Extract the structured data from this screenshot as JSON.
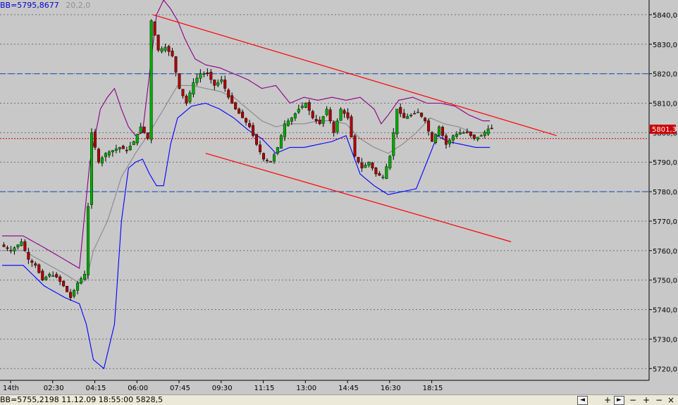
{
  "indicator_label": {
    "value_text": "BB=5795,8677",
    "params_text": "20,2,0",
    "value_color": "#0000cc",
    "params_color": "#909090"
  },
  "status": {
    "text": "BB=5755,2198  11.12.09 18:55:00 5828,5"
  },
  "nav": {
    "icons": [
      "left-arrow-icon",
      "right-arrow-icon",
      "plus-icon",
      "minus-icon",
      "zoom-in-icon",
      "zoom-out-icon",
      "zoom-reset-icon"
    ],
    "glyphs": [
      "◄",
      "►",
      "+",
      "−",
      "+",
      "−",
      "×"
    ]
  },
  "colors": {
    "background": "#c8c8c8",
    "grid": "#707070",
    "candle_up": "#00aa00",
    "candle_down": "#aa0000",
    "wick": "#000000",
    "bb_upper": "#880088",
    "bb_lower": "#0000ff",
    "bb_middle": "#888888",
    "trendline": "#ff0000",
    "level_line": "#3060c0",
    "current_price_line": "#cc0000",
    "price_tag_bg": "#cc0000",
    "price_tag_text": "#ffffff"
  },
  "chart_data": {
    "type": "candlestick",
    "y_axis": {
      "min": 5716,
      "max": 5845,
      "ticks": [
        5720,
        5730,
        5740,
        5750,
        5760,
        5770,
        5780,
        5790,
        5800,
        5810,
        5820,
        5830,
        5840
      ],
      "tick_labels": [
        "5720,0",
        "5730,0",
        "5740,0",
        "5750,0",
        "5760,0",
        "5770,0",
        "5780,0",
        "5790,0",
        "5800,0",
        "5810,0",
        "5820,0",
        "5830,0",
        "5840,0"
      ]
    },
    "x_axis": {
      "bars_total": 142,
      "tick_labels": [
        "14th",
        "02:30",
        "04:15",
        "06:00",
        "07:45",
        "09:30",
        "11:15",
        "13:00",
        "14:45",
        "16:30",
        "18:15"
      ],
      "tick_bars": [
        0,
        12,
        24,
        36,
        48,
        60,
        72,
        84,
        96,
        108,
        120
      ]
    },
    "grid": true,
    "current_price": 5801.3,
    "current_price_label": "5801,3",
    "current_price_line_level": 5798,
    "horizontal_levels": [
      5820,
      5780
    ],
    "trendlines": [
      {
        "from": {
          "bar": 43,
          "price": 5840
        },
        "to": {
          "bar": 158,
          "price": 5799
        }
      },
      {
        "from": {
          "bar": 58,
          "price": 5793
        },
        "to": {
          "bar": 145,
          "price": 5763
        }
      }
    ],
    "price_keypoints": [
      [
        0,
        5762
      ],
      [
        3,
        5760
      ],
      [
        6,
        5763
      ],
      [
        8,
        5757
      ],
      [
        10,
        5755
      ],
      [
        12,
        5750
      ],
      [
        14,
        5752
      ],
      [
        16,
        5751
      ],
      [
        18,
        5748
      ],
      [
        20,
        5744
      ],
      [
        22,
        5749
      ],
      [
        24,
        5752
      ],
      [
        25,
        5775
      ],
      [
        26,
        5800
      ],
      [
        28,
        5790
      ],
      [
        30,
        5793
      ],
      [
        32,
        5794
      ],
      [
        34,
        5795
      ],
      [
        36,
        5794
      ],
      [
        38,
        5797
      ],
      [
        40,
        5802
      ],
      [
        42,
        5798
      ],
      [
        43,
        5838
      ],
      [
        45,
        5828
      ],
      [
        47,
        5829
      ],
      [
        49,
        5826
      ],
      [
        51,
        5815
      ],
      [
        53,
        5810
      ],
      [
        55,
        5817
      ],
      [
        57,
        5820
      ],
      [
        59,
        5820
      ],
      [
        61,
        5816
      ],
      [
        63,
        5818
      ],
      [
        65,
        5812
      ],
      [
        67,
        5808
      ],
      [
        69,
        5805
      ],
      [
        71,
        5802
      ],
      [
        73,
        5796
      ],
      [
        75,
        5791
      ],
      [
        77,
        5790
      ],
      [
        79,
        5795
      ],
      [
        81,
        5803
      ],
      [
        83,
        5805
      ],
      [
        85,
        5808
      ],
      [
        87,
        5810
      ],
      [
        89,
        5805
      ],
      [
        91,
        5803
      ],
      [
        93,
        5808
      ],
      [
        95,
        5800
      ],
      [
        97,
        5808
      ],
      [
        99,
        5805
      ],
      [
        101,
        5792
      ],
      [
        103,
        5788
      ],
      [
        105,
        5790
      ],
      [
        107,
        5786
      ],
      [
        109,
        5785
      ],
      [
        111,
        5792
      ],
      [
        113,
        5808
      ],
      [
        115,
        5805
      ],
      [
        117,
        5806
      ],
      [
        119,
        5807
      ],
      [
        121,
        5804
      ],
      [
        123,
        5797
      ],
      [
        125,
        5802
      ],
      [
        127,
        5796
      ],
      [
        129,
        5799
      ],
      [
        131,
        5800
      ],
      [
        133,
        5800
      ],
      [
        135,
        5798
      ],
      [
        137,
        5799
      ],
      [
        139,
        5801.3
      ]
    ],
    "bollinger_upper": [
      [
        0,
        5765
      ],
      [
        6,
        5765
      ],
      [
        12,
        5761
      ],
      [
        22,
        5754
      ],
      [
        25,
        5790
      ],
      [
        28,
        5808
      ],
      [
        30,
        5812
      ],
      [
        32,
        5815
      ],
      [
        34,
        5808
      ],
      [
        36,
        5802
      ],
      [
        38,
        5799
      ],
      [
        40,
        5800
      ],
      [
        42,
        5820
      ],
      [
        44,
        5840
      ],
      [
        46,
        5845
      ],
      [
        48,
        5842
      ],
      [
        50,
        5838
      ],
      [
        52,
        5832
      ],
      [
        55,
        5825
      ],
      [
        58,
        5823
      ],
      [
        62,
        5822
      ],
      [
        66,
        5820
      ],
      [
        70,
        5818
      ],
      [
        74,
        5815
      ],
      [
        78,
        5816
      ],
      [
        82,
        5810
      ],
      [
        86,
        5812
      ],
      [
        90,
        5811
      ],
      [
        94,
        5812
      ],
      [
        98,
        5811
      ],
      [
        102,
        5812
      ],
      [
        106,
        5808
      ],
      [
        108,
        5803
      ],
      [
        110,
        5806
      ],
      [
        113,
        5811
      ],
      [
        117,
        5812
      ],
      [
        121,
        5810
      ],
      [
        125,
        5810
      ],
      [
        129,
        5809
      ],
      [
        133,
        5806
      ],
      [
        137,
        5804
      ],
      [
        139,
        5804
      ]
    ],
    "bollinger_lower": [
      [
        0,
        5755
      ],
      [
        6,
        5755
      ],
      [
        12,
        5748
      ],
      [
        18,
        5744
      ],
      [
        22,
        5742
      ],
      [
        24,
        5735
      ],
      [
        26,
        5723
      ],
      [
        29,
        5720
      ],
      [
        32,
        5735
      ],
      [
        34,
        5770
      ],
      [
        36,
        5788
      ],
      [
        38,
        5790
      ],
      [
        40,
        5791
      ],
      [
        42,
        5786
      ],
      [
        44,
        5782
      ],
      [
        46,
        5782
      ],
      [
        48,
        5796
      ],
      [
        50,
        5805
      ],
      [
        54,
        5809
      ],
      [
        58,
        5810
      ],
      [
        62,
        5808
      ],
      [
        66,
        5805
      ],
      [
        70,
        5801
      ],
      [
        74,
        5798
      ],
      [
        78,
        5793
      ],
      [
        82,
        5795
      ],
      [
        86,
        5795
      ],
      [
        90,
        5796
      ],
      [
        94,
        5797
      ],
      [
        98,
        5799
      ],
      [
        102,
        5786
      ],
      [
        106,
        5782
      ],
      [
        110,
        5779
      ],
      [
        114,
        5780
      ],
      [
        118,
        5781
      ],
      [
        121,
        5790
      ],
      [
        124,
        5799
      ],
      [
        127,
        5797
      ],
      [
        131,
        5796
      ],
      [
        135,
        5795
      ],
      [
        139,
        5795
      ]
    ],
    "bollinger_middle": [
      [
        0,
        5760
      ],
      [
        6,
        5760
      ],
      [
        12,
        5756
      ],
      [
        18,
        5752
      ],
      [
        22,
        5749
      ],
      [
        24,
        5750
      ],
      [
        26,
        5760
      ],
      [
        30,
        5770
      ],
      [
        34,
        5785
      ],
      [
        38,
        5793
      ],
      [
        42,
        5800
      ],
      [
        46,
        5808
      ],
      [
        50,
        5816
      ],
      [
        54,
        5816
      ],
      [
        58,
        5815
      ],
      [
        62,
        5814
      ],
      [
        66,
        5812
      ],
      [
        70,
        5808
      ],
      [
        74,
        5804
      ],
      [
        78,
        5802
      ],
      [
        82,
        5803
      ],
      [
        86,
        5803
      ],
      [
        90,
        5804
      ],
      [
        94,
        5804
      ],
      [
        98,
        5803
      ],
      [
        102,
        5798
      ],
      [
        106,
        5795
      ],
      [
        110,
        5793
      ],
      [
        114,
        5796
      ],
      [
        118,
        5800
      ],
      [
        122,
        5805
      ],
      [
        126,
        5803
      ],
      [
        130,
        5802
      ],
      [
        134,
        5800
      ],
      [
        139,
        5800
      ]
    ]
  }
}
